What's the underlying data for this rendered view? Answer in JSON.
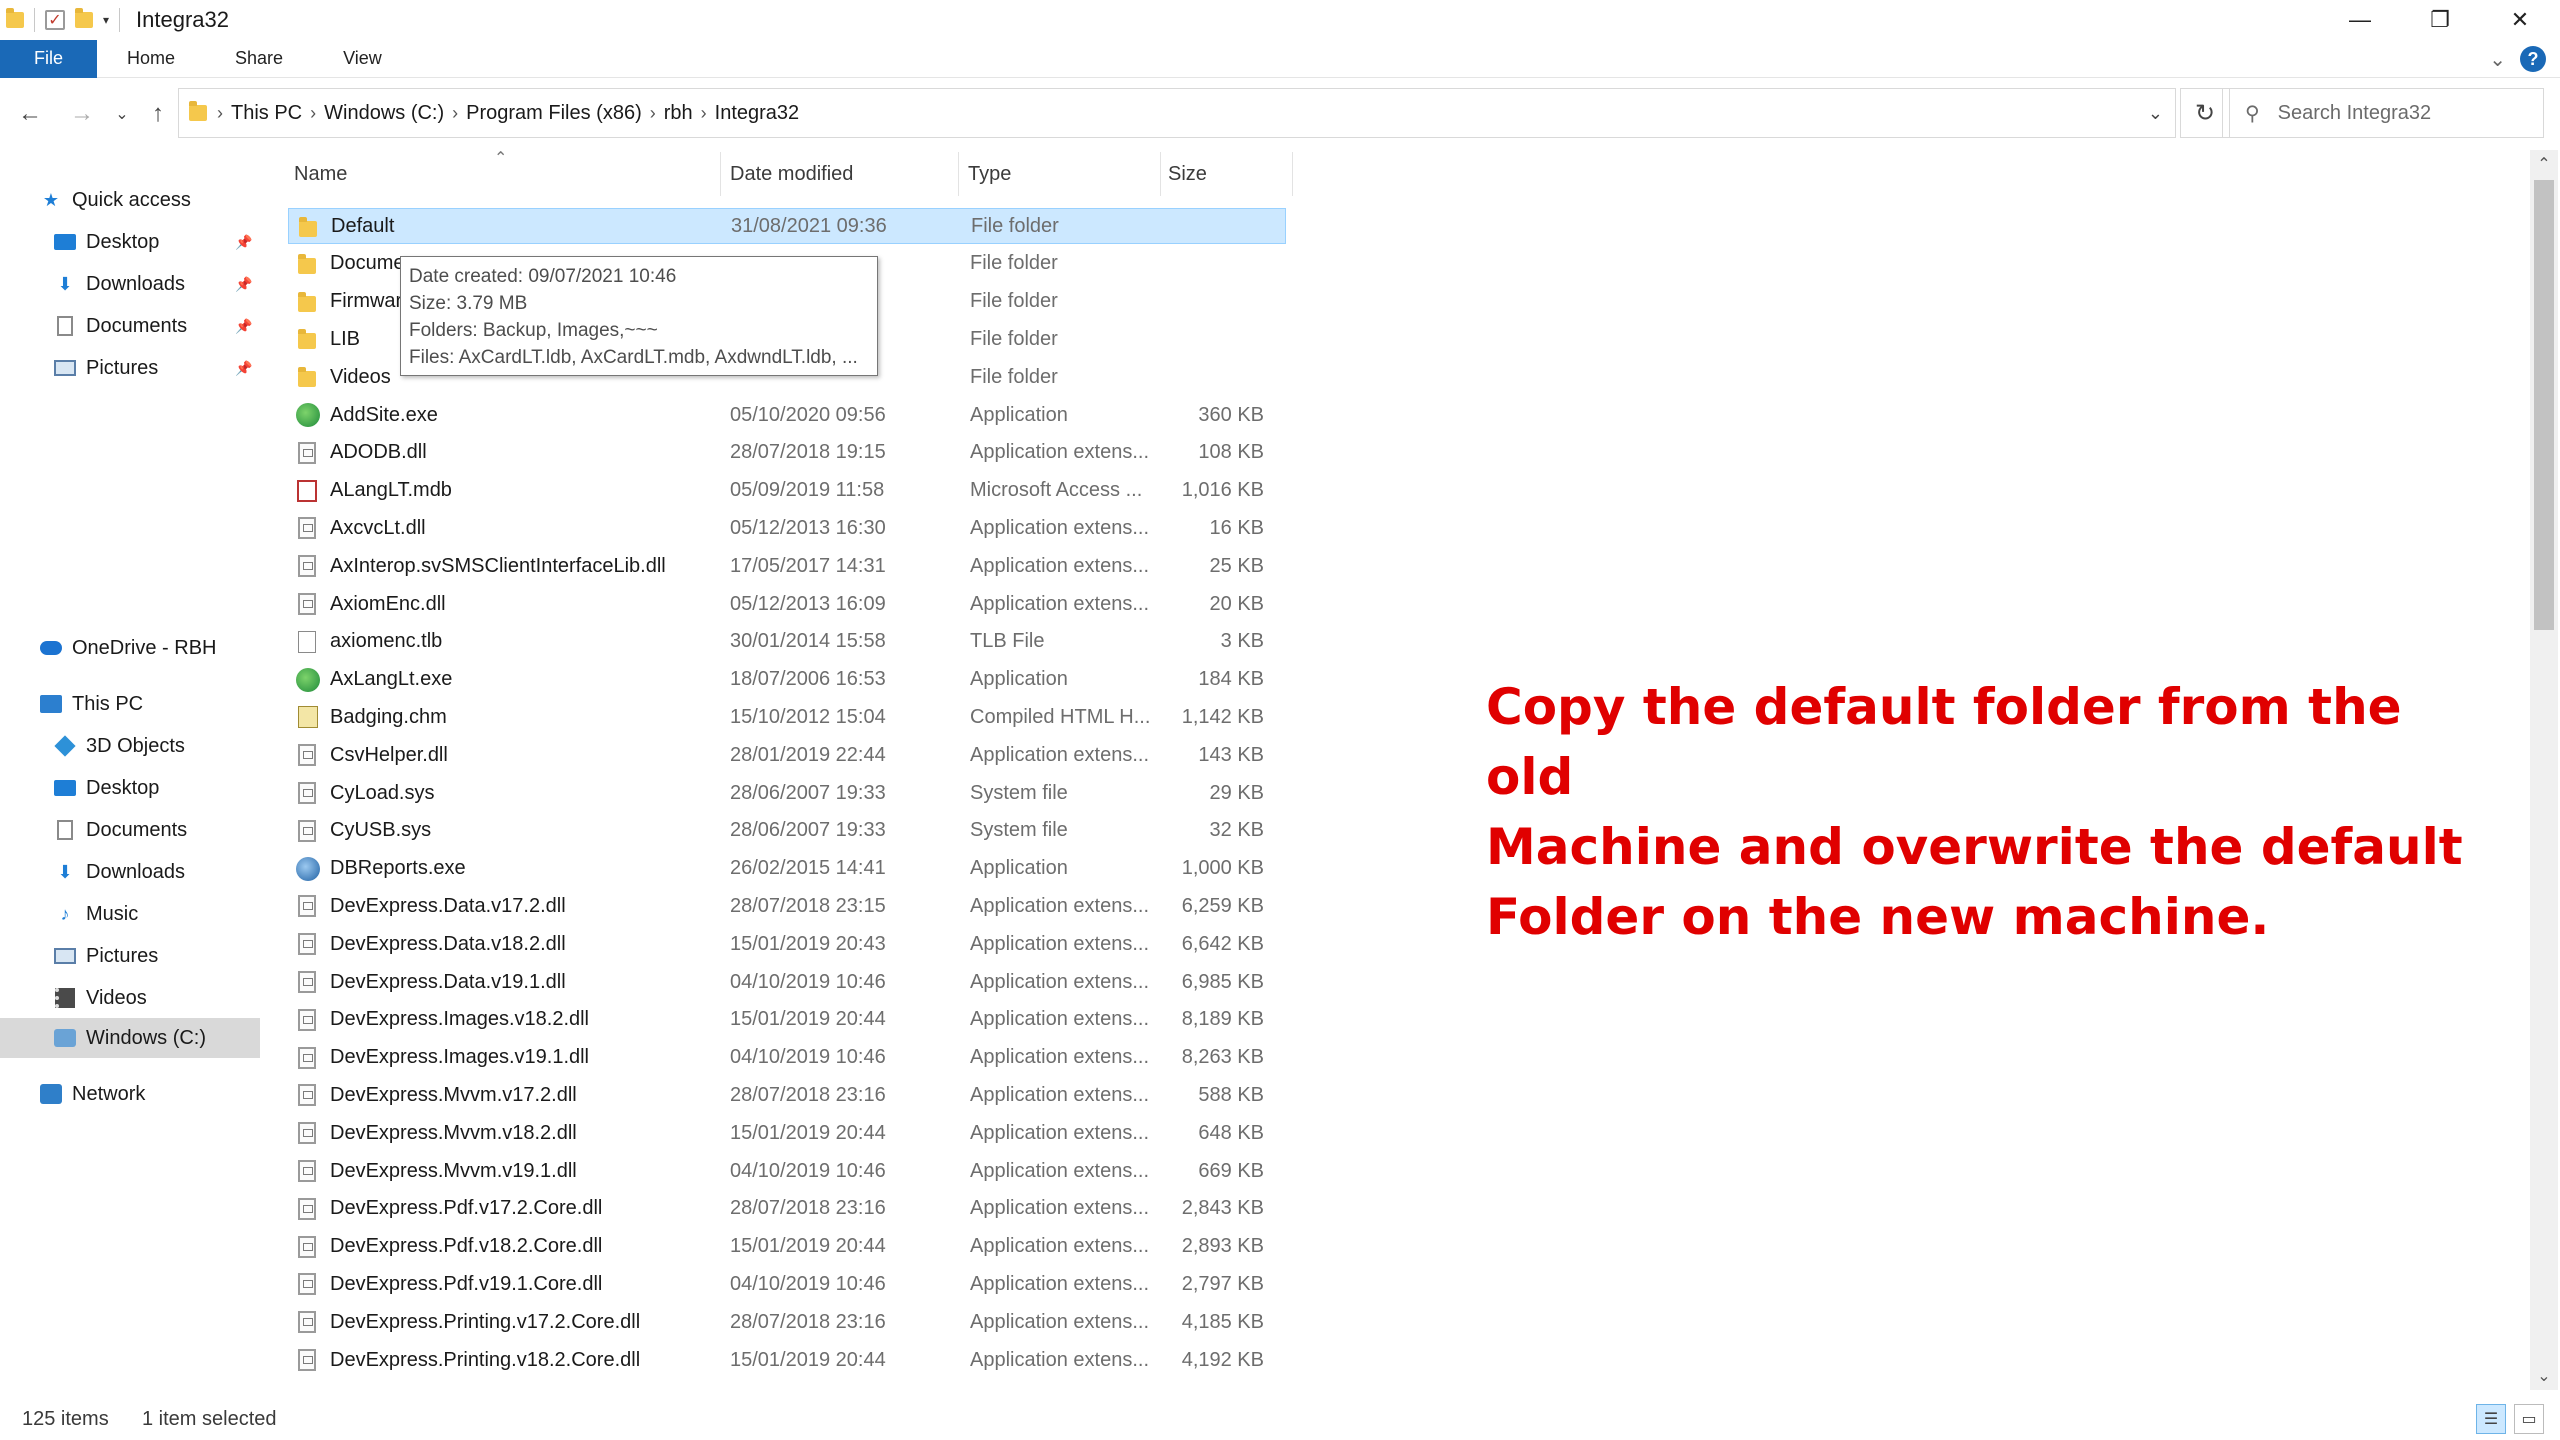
{
  "window": {
    "title": "Integra32"
  },
  "ribbon": {
    "tabs": [
      "File",
      "Home",
      "Share",
      "View"
    ]
  },
  "address": {
    "crumbs": [
      "This PC",
      "Windows (C:)",
      "Program Files (x86)",
      "rbh",
      "Integra32"
    ]
  },
  "search": {
    "placeholder": "Search Integra32"
  },
  "sidebar": {
    "quick_access": "Quick access",
    "quick_items": [
      "Desktop",
      "Downloads",
      "Documents",
      "Pictures"
    ],
    "onedrive": "OneDrive - RBH",
    "this_pc": "This PC",
    "pc_items": [
      "3D Objects",
      "Desktop",
      "Documents",
      "Downloads",
      "Music",
      "Pictures",
      "Videos",
      "Windows (C:)"
    ],
    "network": "Network"
  },
  "columns": {
    "name": "Name",
    "date": "Date modified",
    "type": "Type",
    "size": "Size"
  },
  "files": [
    {
      "name": "Default",
      "date": "31/08/2021 09:36",
      "type": "File folder",
      "size": "",
      "icon": "folder"
    },
    {
      "name": "Docume",
      "date": "",
      "type": "File folder",
      "size": "",
      "icon": "folder"
    },
    {
      "name": "Firmwar",
      "date": "",
      "type": "File folder",
      "size": "",
      "icon": "folder"
    },
    {
      "name": "LIB",
      "date": "",
      "type": "File folder",
      "size": "",
      "icon": "folder"
    },
    {
      "name": "Videos",
      "date": "",
      "type": "File folder",
      "size": "",
      "icon": "folder"
    },
    {
      "name": "AddSite.exe",
      "date": "05/10/2020 09:56",
      "type": "Application",
      "size": "360 KB",
      "icon": "exe"
    },
    {
      "name": "ADODB.dll",
      "date": "28/07/2018 19:15",
      "type": "Application extens...",
      "size": "108 KB",
      "icon": "dll"
    },
    {
      "name": "ALangLT.mdb",
      "date": "05/09/2019 11:58",
      "type": "Microsoft Access ...",
      "size": "1,016 KB",
      "icon": "mdb"
    },
    {
      "name": "AxcvcLt.dll",
      "date": "05/12/2013 16:30",
      "type": "Application extens...",
      "size": "16 KB",
      "icon": "dll"
    },
    {
      "name": "AxInterop.svSMSClientInterfaceLib.dll",
      "date": "17/05/2017 14:31",
      "type": "Application extens...",
      "size": "25 KB",
      "icon": "dll"
    },
    {
      "name": "AxiomEnc.dll",
      "date": "05/12/2013 16:09",
      "type": "Application extens...",
      "size": "20 KB",
      "icon": "dll"
    },
    {
      "name": "axiomenc.tlb",
      "date": "30/01/2014 15:58",
      "type": "TLB File",
      "size": "3 KB",
      "icon": "tlb"
    },
    {
      "name": "AxLangLt.exe",
      "date": "18/07/2006 16:53",
      "type": "Application",
      "size": "184 KB",
      "icon": "exe"
    },
    {
      "name": "Badging.chm",
      "date": "15/10/2012 15:04",
      "type": "Compiled HTML H...",
      "size": "1,142 KB",
      "icon": "chm"
    },
    {
      "name": "CsvHelper.dll",
      "date": "28/01/2019 22:44",
      "type": "Application extens...",
      "size": "143 KB",
      "icon": "dll"
    },
    {
      "name": "CyLoad.sys",
      "date": "28/06/2007 19:33",
      "type": "System file",
      "size": "29 KB",
      "icon": "dll"
    },
    {
      "name": "CyUSB.sys",
      "date": "28/06/2007 19:33",
      "type": "System file",
      "size": "32 KB",
      "icon": "dll"
    },
    {
      "name": "DBReports.exe",
      "date": "26/02/2015 14:41",
      "type": "Application",
      "size": "1,000 KB",
      "icon": "db"
    },
    {
      "name": "DevExpress.Data.v17.2.dll",
      "date": "28/07/2018 23:15",
      "type": "Application extens...",
      "size": "6,259 KB",
      "icon": "dll"
    },
    {
      "name": "DevExpress.Data.v18.2.dll",
      "date": "15/01/2019 20:43",
      "type": "Application extens...",
      "size": "6,642 KB",
      "icon": "dll"
    },
    {
      "name": "DevExpress.Data.v19.1.dll",
      "date": "04/10/2019 10:46",
      "type": "Application extens...",
      "size": "6,985 KB",
      "icon": "dll"
    },
    {
      "name": "DevExpress.Images.v18.2.dll",
      "date": "15/01/2019 20:44",
      "type": "Application extens...",
      "size": "8,189 KB",
      "icon": "dll"
    },
    {
      "name": "DevExpress.Images.v19.1.dll",
      "date": "04/10/2019 10:46",
      "type": "Application extens...",
      "size": "8,263 KB",
      "icon": "dll"
    },
    {
      "name": "DevExpress.Mvvm.v17.2.dll",
      "date": "28/07/2018 23:16",
      "type": "Application extens...",
      "size": "588 KB",
      "icon": "dll"
    },
    {
      "name": "DevExpress.Mvvm.v18.2.dll",
      "date": "15/01/2019 20:44",
      "type": "Application extens...",
      "size": "648 KB",
      "icon": "dll"
    },
    {
      "name": "DevExpress.Mvvm.v19.1.dll",
      "date": "04/10/2019 10:46",
      "type": "Application extens...",
      "size": "669 KB",
      "icon": "dll"
    },
    {
      "name": "DevExpress.Pdf.v17.2.Core.dll",
      "date": "28/07/2018 23:16",
      "type": "Application extens...",
      "size": "2,843 KB",
      "icon": "dll"
    },
    {
      "name": "DevExpress.Pdf.v18.2.Core.dll",
      "date": "15/01/2019 20:44",
      "type": "Application extens...",
      "size": "2,893 KB",
      "icon": "dll"
    },
    {
      "name": "DevExpress.Pdf.v19.1.Core.dll",
      "date": "04/10/2019 10:46",
      "type": "Application extens...",
      "size": "2,797 KB",
      "icon": "dll"
    },
    {
      "name": "DevExpress.Printing.v17.2.Core.dll",
      "date": "28/07/2018 23:16",
      "type": "Application extens...",
      "size": "4,185 KB",
      "icon": "dll"
    },
    {
      "name": "DevExpress.Printing.v18.2.Core.dll",
      "date": "15/01/2019 20:44",
      "type": "Application extens...",
      "size": "4,192 KB",
      "icon": "dll"
    }
  ],
  "tooltip": {
    "line1": "Date created: 09/07/2021 10:46",
    "line2": "Size: 3.79 MB",
    "line3": "Folders: Backup, Images,~~~",
    "line4": "Files: AxCardLT.ldb, AxCardLT.mdb, AxdwndLT.ldb, ..."
  },
  "callout": {
    "line1": "Copy the default folder from the old",
    "line2": "Machine and overwrite the default",
    "line3": "Folder on the new machine.",
    "color": "#e00000"
  },
  "status": {
    "count": "125 items",
    "selected": "1 item selected"
  },
  "colors": {
    "accent": "#1a69b7",
    "selection": "#cce8ff"
  }
}
